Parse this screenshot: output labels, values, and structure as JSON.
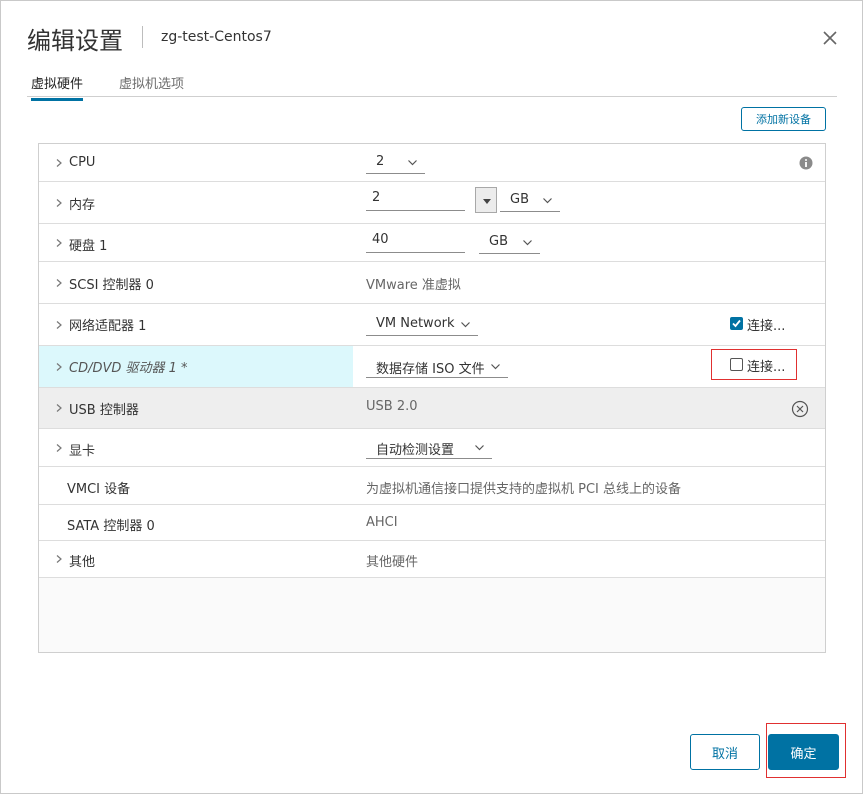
{
  "header": {
    "title": "编辑设置",
    "vm_name": "zg-test-Centos7"
  },
  "tabs": [
    {
      "label": "虚拟硬件",
      "active": true
    },
    {
      "label": "虚拟机选项",
      "active": false
    }
  ],
  "add_device_label": "添加新设备",
  "rows": {
    "cpu": {
      "label": "CPU",
      "value": "2"
    },
    "memory": {
      "label": "内存",
      "value": "2",
      "unit": "GB"
    },
    "disk": {
      "label": "硬盘 1",
      "value": "40",
      "unit": "GB"
    },
    "scsi": {
      "label": "SCSI 控制器 0",
      "value": "VMware 准虚拟"
    },
    "network": {
      "label": "网络适配器 1",
      "value": "VM Network",
      "connect_label": "连接...",
      "connected": true
    },
    "cddvd": {
      "label": "CD/DVD 驱动器 1 *",
      "value": "数据存储 ISO 文件",
      "connect_label": "连接...",
      "connected": false
    },
    "usb": {
      "label": "USB 控制器",
      "value": "USB 2.0"
    },
    "video": {
      "label": "显卡",
      "value": "自动检测设置"
    },
    "vmci": {
      "label": "VMCI 设备",
      "value": "为虚拟机通信接口提供支持的虚拟机 PCI 总线上的设备"
    },
    "sata": {
      "label": "SATA 控制器 0",
      "value": "AHCI"
    },
    "other": {
      "label": "其他",
      "value": "其他硬件"
    }
  },
  "footer": {
    "cancel_label": "取消",
    "ok_label": "确定"
  },
  "colors": {
    "accent": "#0072a3",
    "highlight": "#dcf8fc",
    "annotation": "#e03030"
  }
}
